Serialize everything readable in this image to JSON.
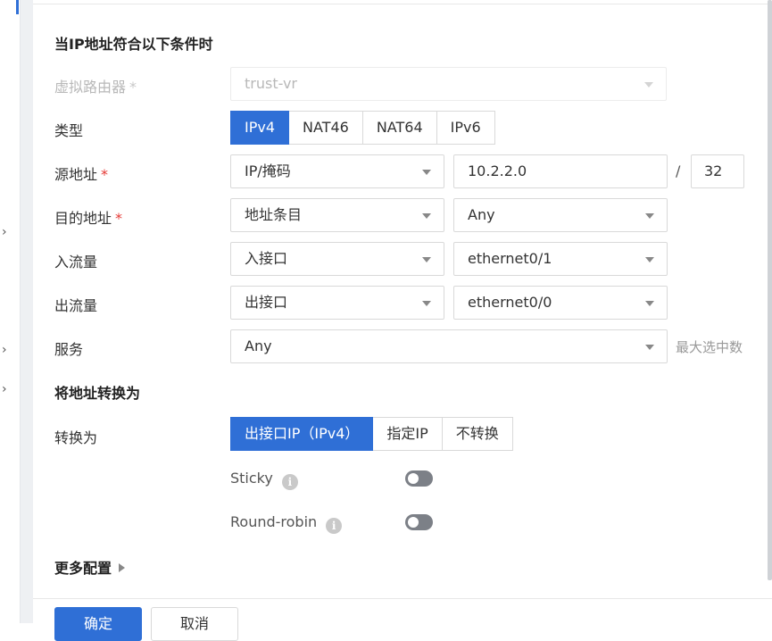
{
  "condition_section": {
    "title": "当IP地址符合以下条件时"
  },
  "virtual_router": {
    "label": "虚拟路由器",
    "value": "trust-vr"
  },
  "type": {
    "label": "类型",
    "options": [
      "IPv4",
      "NAT46",
      "NAT64",
      "IPv6"
    ],
    "selected": "IPv4"
  },
  "source": {
    "label": "源地址",
    "mode": "IP/掩码",
    "ip": "10.2.2.0",
    "separator": "/",
    "mask": "32"
  },
  "destination": {
    "label": "目的地址",
    "mode": "地址条目",
    "value": "Any"
  },
  "ingress": {
    "label": "入流量",
    "mode": "入接口",
    "value": "ethernet0/1"
  },
  "egress": {
    "label": "出流量",
    "mode": "出接口",
    "value": "ethernet0/0"
  },
  "service": {
    "label": "服务",
    "value": "Any",
    "hint": "最大选中数"
  },
  "translate_section": {
    "title": "将地址转换为"
  },
  "translate_to": {
    "label": "转换为",
    "options": [
      "出接口IP（IPv4）",
      "指定IP",
      "不转换"
    ],
    "selected": "出接口IP（IPv4）"
  },
  "sticky": {
    "label": "Sticky",
    "on": false
  },
  "round_robin": {
    "label": "Round-robin",
    "on": false
  },
  "more": {
    "label": "更多配置"
  },
  "footer": {
    "confirm": "确定",
    "cancel": "取消"
  },
  "required_mark": "*",
  "info_glyph": "i",
  "colors": {
    "primary": "#2f6fd6",
    "required": "#e53935",
    "toggle_off": "#7c8087"
  }
}
